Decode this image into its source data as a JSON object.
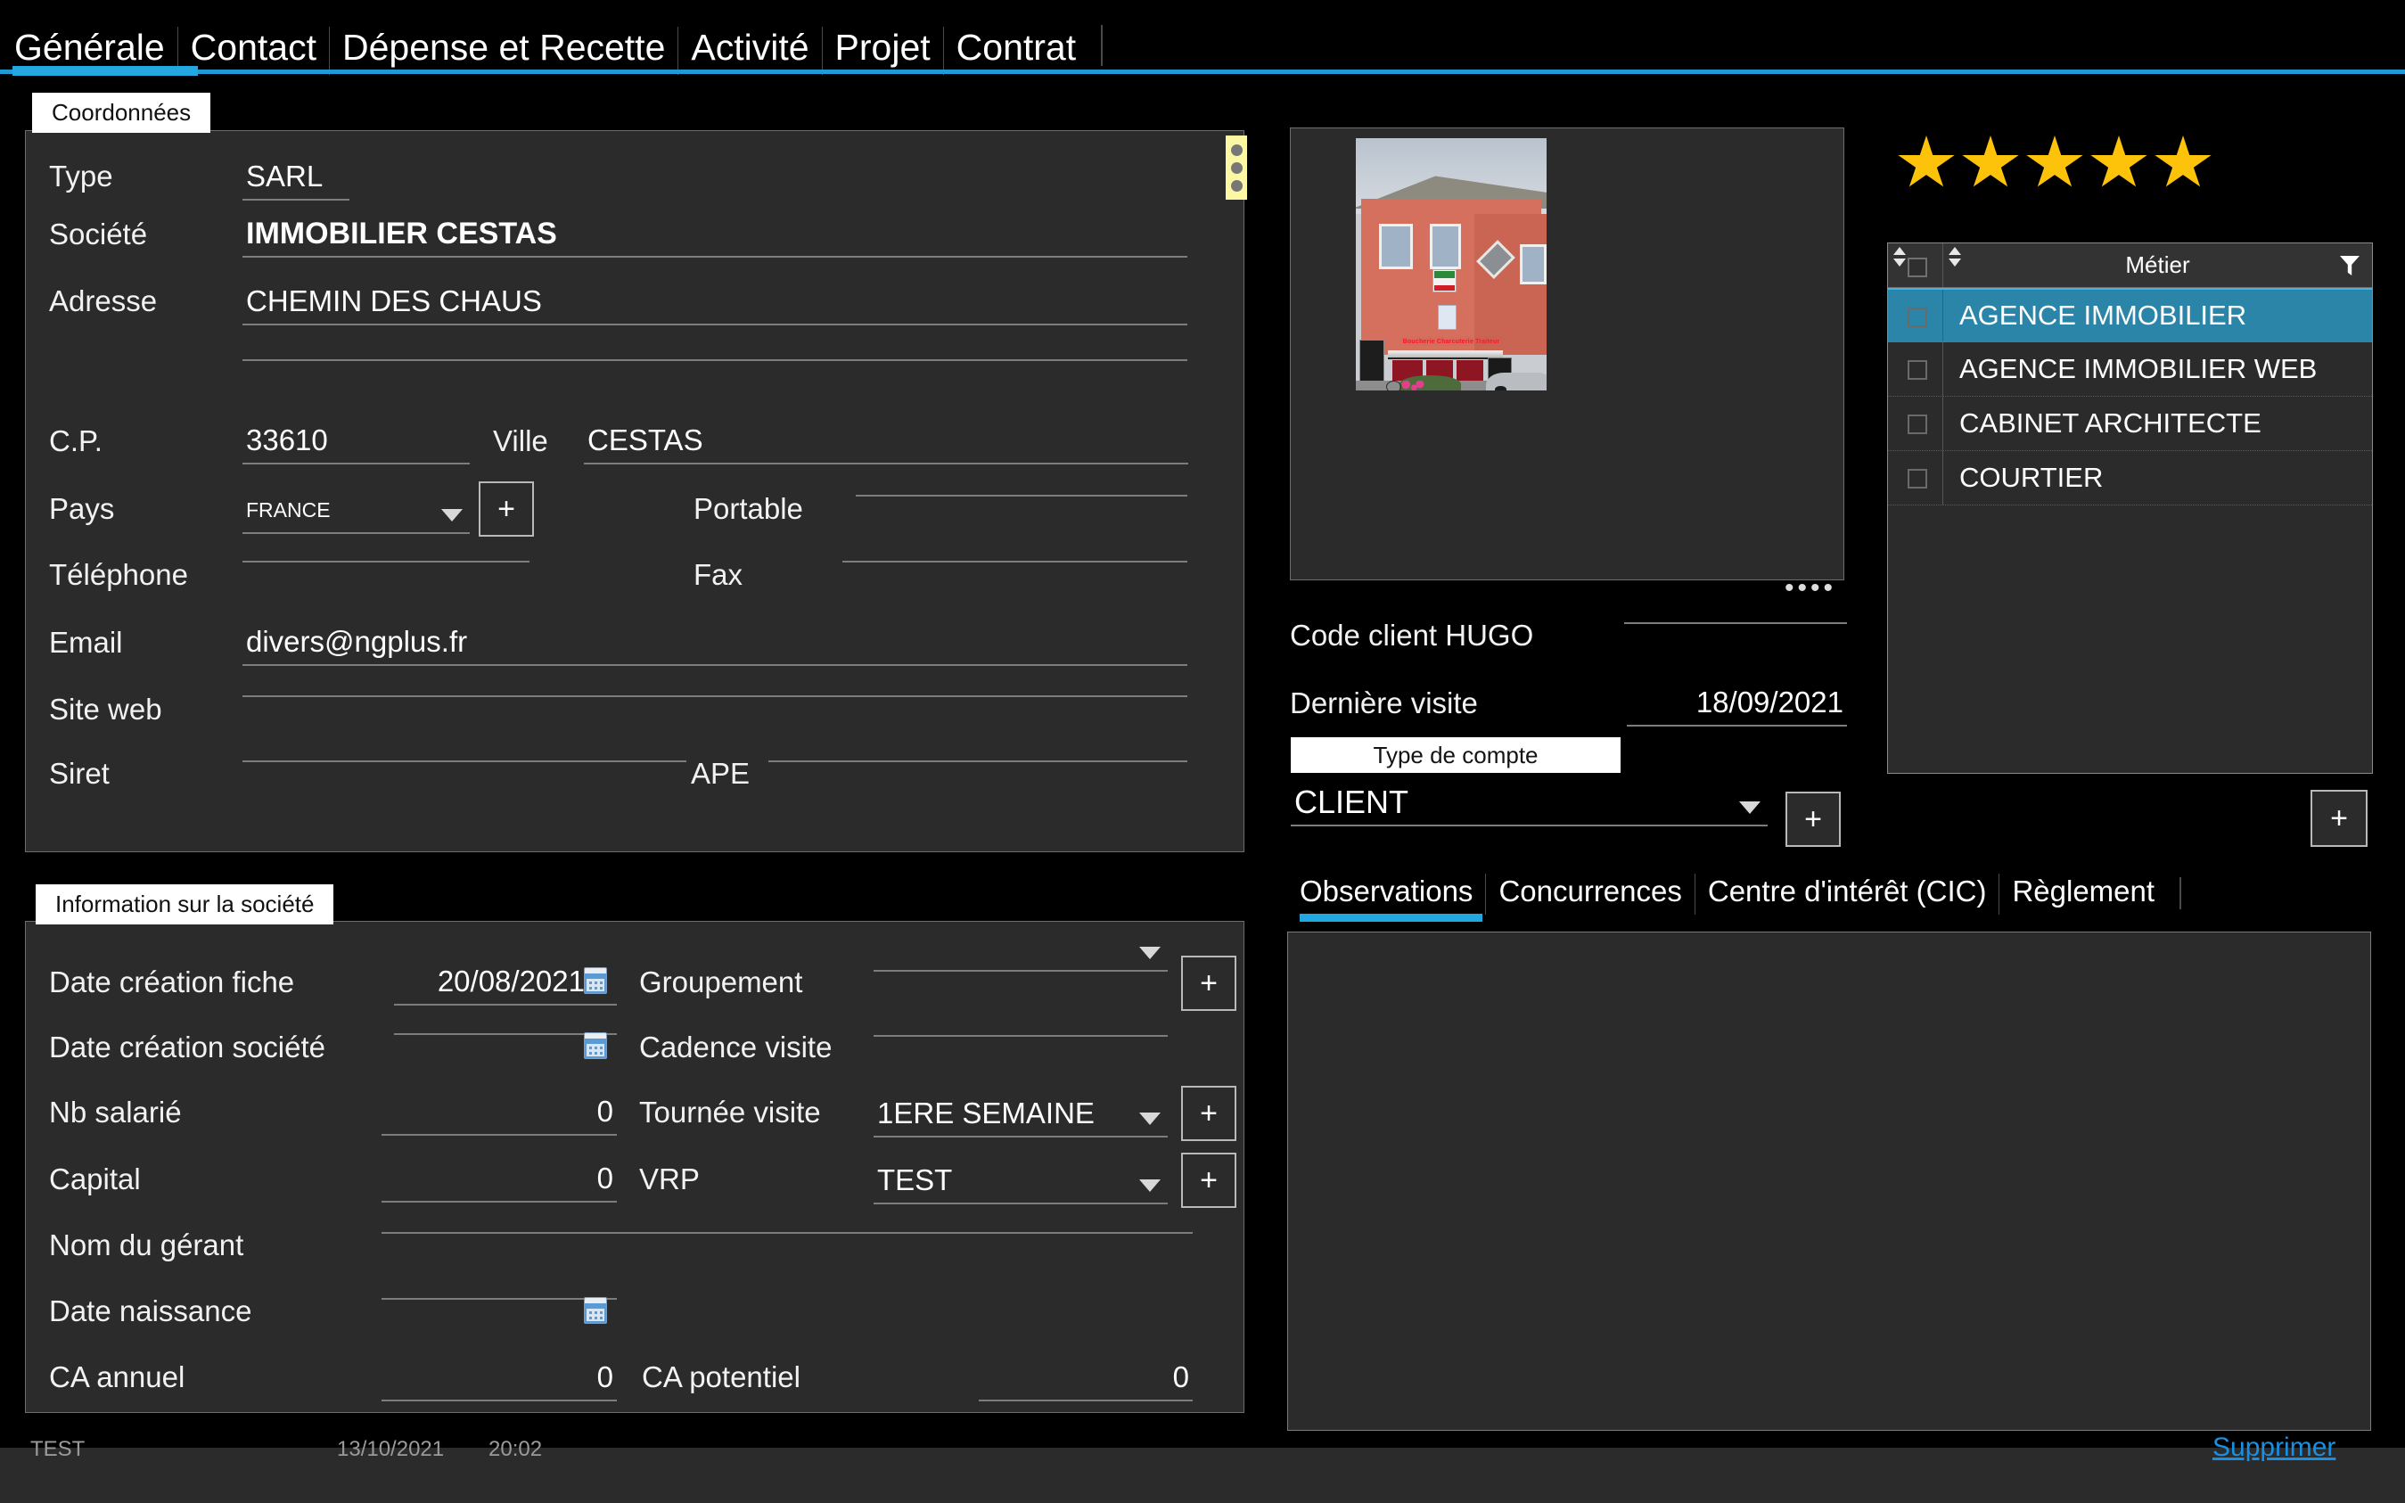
{
  "tabs": [
    {
      "label": "Générale",
      "active": true
    },
    {
      "label": "Contact",
      "active": false
    },
    {
      "label": "Dépense et Recette",
      "active": false
    },
    {
      "label": "Activité",
      "active": false
    },
    {
      "label": "Projet",
      "active": false
    },
    {
      "label": "Contrat",
      "active": false
    }
  ],
  "coordonnees": {
    "group_title": "Coordonnées",
    "type_label": "Type",
    "type_value": "SARL",
    "societe_label": "Société",
    "societe_value": "IMMOBILIER CESTAS",
    "adresse_label": "Adresse",
    "adresse_value": "CHEMIN DES CHAUS",
    "adresse2_value": "",
    "cp_label": "C.P.",
    "cp_value": "33610",
    "ville_label": "Ville",
    "ville_value": "CESTAS",
    "pays_label": "Pays",
    "pays_value": "FRANCE",
    "pays_add_label": "+",
    "portable_label": "Portable",
    "portable_value": "",
    "telephone_label": "Téléphone",
    "telephone_value": "",
    "fax_label": "Fax",
    "fax_value": "",
    "email_label": "Email",
    "email_value": "divers@ngplus.fr",
    "siteweb_label": "Site web",
    "siteweb_value": "",
    "siret_label": "Siret",
    "siret_value": "",
    "ape_label": "APE",
    "ape_value": ""
  },
  "societe_info": {
    "group_title": "Information sur la société",
    "date_creation_fiche_label": "Date création fiche",
    "date_creation_fiche_value": "20/08/2021",
    "date_creation_societe_label": "Date création société",
    "date_creation_societe_value": "",
    "nb_salarie_label": "Nb salarié",
    "nb_salarie_value": "0",
    "capital_label": "Capital",
    "capital_value": "0",
    "nom_gerant_label": "Nom du gérant",
    "nom_gerant_value": "",
    "date_naissance_label": "Date naissance",
    "date_naissance_value": "",
    "ca_annuel_label": "CA annuel",
    "ca_annuel_value": "0",
    "ca_potentiel_label": "CA potentiel",
    "ca_potentiel_value": "0",
    "groupement_label": "Groupement",
    "groupement_value": "",
    "groupement_add_label": "+",
    "cadence_visite_label": "Cadence visite",
    "cadence_visite_value": "",
    "tournee_visite_label": "Tournée visite",
    "tournee_visite_value": "1ERE SEMAINE",
    "tournee_add_label": "+",
    "vrp_label": "VRP",
    "vrp_value": "TEST",
    "vrp_add_label": "+"
  },
  "center": {
    "photo_caption": "Boucherie Charcuterie Traiteur",
    "photo_dots": "••••",
    "code_client_label": "Code client HUGO",
    "code_client_value": "",
    "derniere_visite_label": "Dernière visite",
    "derniere_visite_value": "18/09/2021",
    "type_compte_label": "Type de compte",
    "type_compte_value": "CLIENT",
    "type_compte_add_label": "+"
  },
  "rating": {
    "count": 5,
    "color": "#fdc30b"
  },
  "metier_grid": {
    "header": "Métier",
    "rows": [
      {
        "label": "AGENCE IMMOBILIER",
        "selected": true
      },
      {
        "label": "AGENCE IMMOBILIER WEB",
        "selected": false
      },
      {
        "label": "CABINET ARCHITECTE",
        "selected": false
      },
      {
        "label": "COURTIER",
        "selected": false
      }
    ],
    "add_label": "+"
  },
  "sub_tabs": [
    {
      "label": "Observations",
      "active": true
    },
    {
      "label": "Concurrences",
      "active": false
    },
    {
      "label": "Centre d'intérêt (CIC)",
      "active": false
    },
    {
      "label": "Règlement",
      "active": false
    }
  ],
  "observations_text": "",
  "status": {
    "user": "TEST",
    "date": "13/10/2021",
    "time": "20:02",
    "delete_label": "Supprimer"
  },
  "colors": {
    "accent": "#22a7e0",
    "panel_bg": "#2b2b2b",
    "row_selected": "#2b85a8",
    "link": "#1a8fe0",
    "star": "#fdc30b",
    "drag_handle": "#fbf7a3"
  }
}
